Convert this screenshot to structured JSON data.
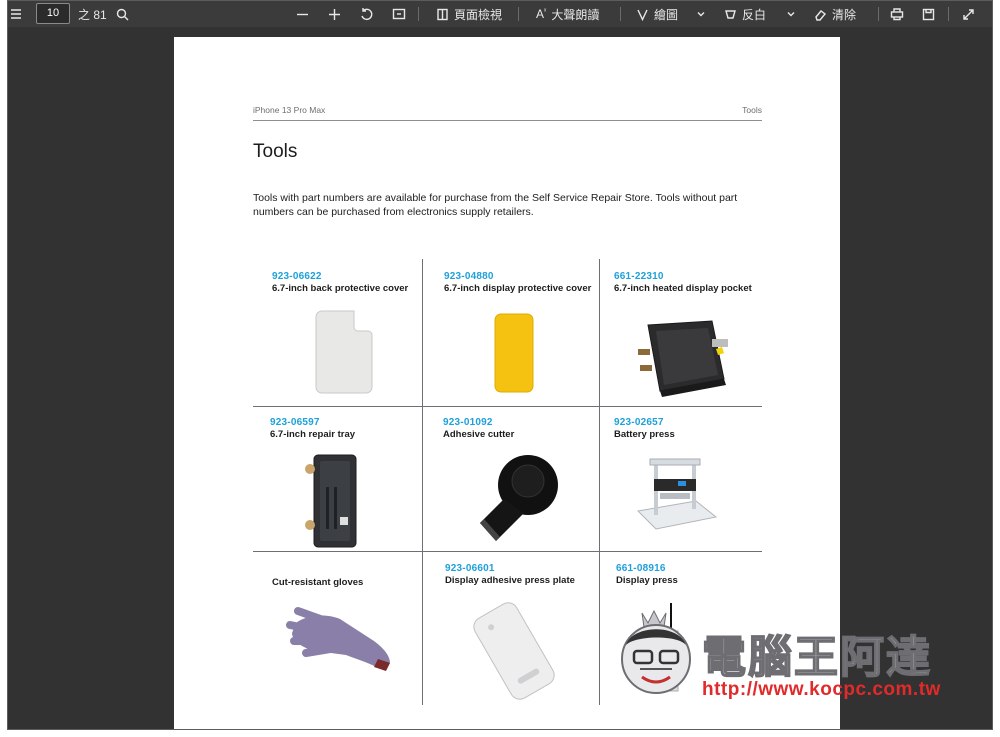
{
  "toolbar": {
    "page_current": "10",
    "page_total": "之 81",
    "view_label": "頁面檢視",
    "read_aloud_label": "大聲朗讀",
    "draw_label": "繪圖",
    "highlight_label": "反白",
    "erase_label": "清除"
  },
  "document": {
    "header_left": "iPhone 13 Pro Max",
    "header_right": "Tools",
    "title": "Tools",
    "intro": "Tools with part numbers are available for purchase from the Self Service Repair Store. Tools without part numbers can be purchased from electronics supply retailers.",
    "tools": [
      {
        "part_number": "923-06622",
        "name": "6.7-inch back protective cover"
      },
      {
        "part_number": "923-04880",
        "name": "6.7-inch display protective cover"
      },
      {
        "part_number": "661-22310",
        "name": "6.7-inch heated display pocket"
      },
      {
        "part_number": "923-06597",
        "name": "6.7-inch repair tray"
      },
      {
        "part_number": "923-01092",
        "name": "Adhesive cutter"
      },
      {
        "part_number": "923-02657",
        "name": "Battery press"
      },
      {
        "part_number": "",
        "name": "Cut-resistant gloves"
      },
      {
        "part_number": "923-06601",
        "name": "Display adhesive press plate"
      },
      {
        "part_number": "661-08916",
        "name": "Display press"
      }
    ]
  },
  "watermark": {
    "text": "電腦王阿達",
    "url": "http://www.kocpc.com.tw"
  },
  "colors": {
    "viewer_bg": "#323232",
    "part_number_blue": "#1ea0db",
    "watermark_red": "#e12a2a"
  }
}
